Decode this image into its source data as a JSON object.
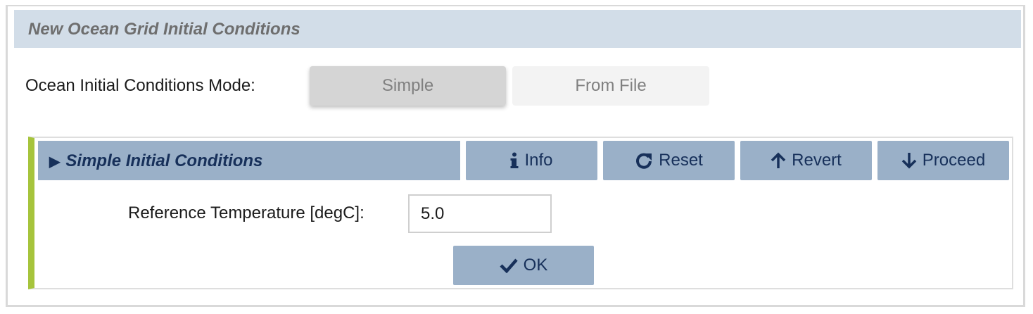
{
  "header": {
    "title": "New Ocean Grid Initial Conditions"
  },
  "mode": {
    "label": "Ocean Initial Conditions Mode:",
    "options": [
      {
        "label": "Simple",
        "selected": true
      },
      {
        "label": "From File",
        "selected": false
      }
    ]
  },
  "section": {
    "title": "Simple Initial Conditions",
    "expand_icon": "triangle-right-icon",
    "buttons": {
      "info": {
        "label": "Info",
        "icon": "info-icon"
      },
      "reset": {
        "label": "Reset",
        "icon": "redo-arrow-icon"
      },
      "revert": {
        "label": "Revert",
        "icon": "arrow-up-icon"
      },
      "proceed": {
        "label": "Proceed",
        "icon": "arrow-down-icon"
      }
    },
    "reference_temperature": {
      "label": "Reference Temperature [degC]:",
      "value": "5.0"
    },
    "ok_button": {
      "label": "OK",
      "icon": "checkmark-icon"
    }
  },
  "colors": {
    "header_bg": "#d2dde8",
    "button_bg": "#9ab0c8",
    "button_text": "#17305a",
    "panel_accent": "#a6c43c"
  }
}
